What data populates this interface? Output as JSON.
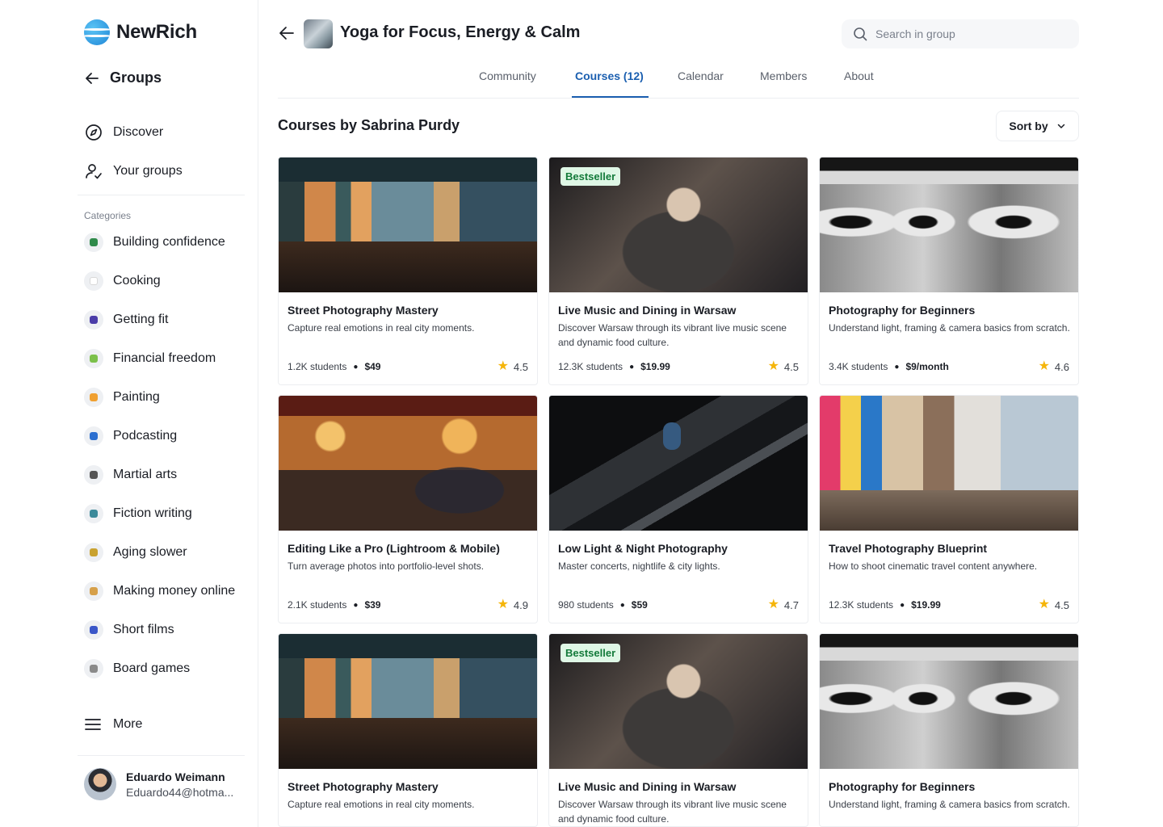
{
  "app": {
    "name": "NewRich"
  },
  "sidebar": {
    "back_label": "Groups",
    "nav": [
      {
        "label": "Discover",
        "icon": "compass-icon"
      },
      {
        "label": "Your groups",
        "icon": "user-group-icon"
      }
    ],
    "categories_title": "Categories",
    "categories": [
      {
        "label": "Building confidence",
        "icon": "person-icon",
        "color": "#2f8a4a"
      },
      {
        "label": "Cooking",
        "icon": "chef-hat-icon",
        "color": "#e6e6e6"
      },
      {
        "label": "Getting fit",
        "icon": "dumbbell-icon",
        "color": "#4a3ca8"
      },
      {
        "label": "Financial freedom",
        "icon": "money-icon",
        "color": "#7bc04a"
      },
      {
        "label": "Painting",
        "icon": "palette-icon",
        "color": "#f0a030"
      },
      {
        "label": "Podcasting",
        "icon": "microphone-icon",
        "color": "#2b6fd0"
      },
      {
        "label": "Martial arts",
        "icon": "martial-arts-icon",
        "color": "#555555"
      },
      {
        "label": "Fiction writing",
        "icon": "ufo-icon",
        "color": "#3c8a9a"
      },
      {
        "label": "Aging slower",
        "icon": "sparkle-icon",
        "color": "#c9a230"
      },
      {
        "label": "Making money online",
        "icon": "laptop-money-icon",
        "color": "#d6a04a"
      },
      {
        "label": "Short films",
        "icon": "clapperboard-icon",
        "color": "#3a56c8"
      },
      {
        "label": "Board games",
        "icon": "chess-pawn-icon",
        "color": "#8a8a8a"
      }
    ],
    "more_label": "More",
    "user": {
      "name": "Eduardo Weimann",
      "email": "Eduardo44@hotma..."
    }
  },
  "header": {
    "group_title": "Yoga for Focus, Energy & Calm",
    "search_placeholder": "Search in group",
    "tabs": [
      {
        "label": "Community",
        "active": false
      },
      {
        "label": "Courses (12)",
        "active": true
      },
      {
        "label": "Calendar",
        "active": false
      },
      {
        "label": "Members",
        "active": false
      },
      {
        "label": "About",
        "active": false
      }
    ]
  },
  "main": {
    "section_title": "Courses by Sabrina Purdy",
    "sort_label": "Sort by",
    "courses": [
      {
        "title": "Street Photography Mastery",
        "desc": "Capture real emotions in real city moments.",
        "students": "1.2K students",
        "price": "$49",
        "rating": "4.5",
        "badge": "",
        "image": "mural"
      },
      {
        "title": "Live Music and Dining in Warsaw",
        "desc": "Discover Warsaw through its vibrant live music scene and dynamic food culture.",
        "students": "12.3K students",
        "price": "$19.99",
        "rating": "4.5",
        "badge": "Bestseller",
        "image": "music"
      },
      {
        "title": "Photography for Beginners",
        "desc": "Understand light, framing & camera basics from scratch.",
        "students": "3.4K students",
        "price": "$9/month",
        "rating": "4.6",
        "badge": "",
        "image": "eyes"
      },
      {
        "title": "Editing Like a Pro (Lightroom & Mobile)",
        "desc": "Turn average photos into portfolio-level shots.",
        "students": "2.1K students",
        "price": "$39",
        "rating": "4.9",
        "badge": "",
        "image": "bakery"
      },
      {
        "title": "Low Light & Night Photography",
        "desc": "Master concerts, nightlife & city lights.",
        "students": "980 students",
        "price": "$59",
        "rating": "4.7",
        "badge": "",
        "image": "escalator"
      },
      {
        "title": "Travel Photography Blueprint",
        "desc": "How to shoot cinematic travel content anywhere.",
        "students": "12.3K students",
        "price": "$19.99",
        "rating": "4.5",
        "badge": "",
        "image": "street"
      },
      {
        "title": "Street Photography Mastery",
        "desc": "Capture real emotions in real city moments.",
        "students": "",
        "price": "",
        "rating": "",
        "badge": "",
        "image": "mural"
      },
      {
        "title": "Live Music and Dining in Warsaw",
        "desc": "Discover Warsaw through its vibrant live music scene and dynamic food culture.",
        "students": "",
        "price": "",
        "rating": "",
        "badge": "Bestseller",
        "image": "music"
      },
      {
        "title": "Photography for Beginners",
        "desc": "Understand light, framing & camera basics from scratch.",
        "students": "",
        "price": "",
        "rating": "",
        "badge": "",
        "image": "eyes"
      }
    ]
  },
  "colors": {
    "accent": "#1b5fb0",
    "badge_bg": "#dff7e6",
    "badge_text": "#137a3a",
    "star": "#f5b50a"
  }
}
